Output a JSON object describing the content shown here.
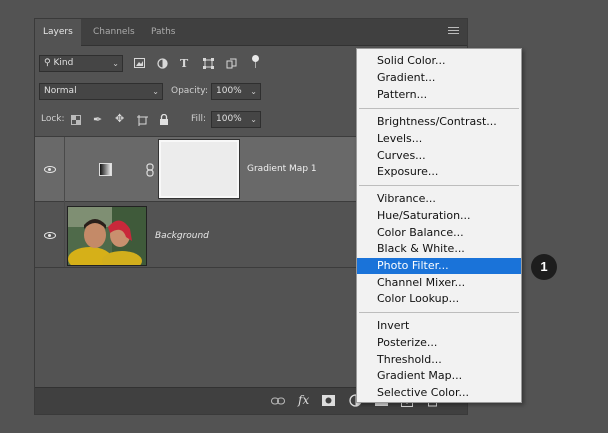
{
  "tabs": [
    {
      "label": "Layers",
      "active": true
    },
    {
      "label": "Channels",
      "active": false
    },
    {
      "label": "Paths",
      "active": false
    }
  ],
  "filter": {
    "kind_label": "Kind",
    "icons": [
      "image-filter-icon",
      "adjustment-filter-icon",
      "type-filter-icon",
      "shape-filter-icon",
      "smart-object-filter-icon",
      "filter-toggle-icon"
    ]
  },
  "blend": {
    "mode": "Normal",
    "opacity_label": "Opacity:",
    "opacity_value": "100%"
  },
  "lock": {
    "label": "Lock:",
    "fill_label": "Fill:",
    "fill_value": "100%"
  },
  "layers": [
    {
      "name": "Gradient Map 1",
      "type": "adjustment",
      "visible": true,
      "selected": true
    },
    {
      "name": "Background",
      "type": "image",
      "visible": true,
      "selected": false
    }
  ],
  "bottom_icons": [
    "link-layers-icon",
    "fx-icon",
    "add-mask-icon",
    "new-adjustment-layer-icon",
    "new-group-icon",
    "new-layer-icon",
    "delete-layer-icon"
  ],
  "bottom_fx_label": "fx",
  "menu": {
    "groups": [
      [
        "Solid Color...",
        "Gradient...",
        "Pattern..."
      ],
      [
        "Brightness/Contrast...",
        "Levels...",
        "Curves...",
        "Exposure..."
      ],
      [
        "Vibrance...",
        "Hue/Saturation...",
        "Color Balance...",
        "Black & White...",
        "Photo Filter...",
        "Channel Mixer...",
        "Color Lookup..."
      ],
      [
        "Invert",
        "Posterize...",
        "Threshold...",
        "Gradient Map...",
        "Selective Color..."
      ]
    ],
    "highlighted": "Photo Filter..."
  },
  "callout": {
    "number": "1"
  },
  "colors": {
    "panel_bg": "#535353",
    "selection": "#1a73d9",
    "menu_bg": "#f2f2f2"
  }
}
